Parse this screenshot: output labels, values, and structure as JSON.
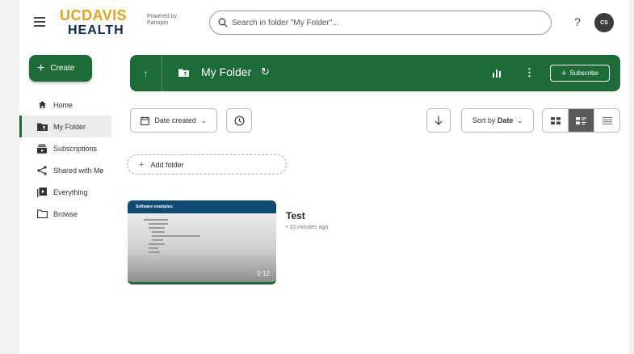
{
  "header": {
    "logo_uc": "UCDAVIS",
    "logo_health": "HEALTH",
    "powered_line1": "Powered by",
    "powered_line2": "Panopto",
    "search_placeholder": "Search in folder \"My Folder\"...",
    "help": "?",
    "avatar_initials": "CS"
  },
  "sidebar": {
    "create_label": "Create",
    "items": [
      {
        "label": "Home",
        "icon": "home-icon"
      },
      {
        "label": "My Folder",
        "icon": "folder-user-icon",
        "active": true
      },
      {
        "label": "Subscriptions",
        "icon": "subscriptions-icon"
      },
      {
        "label": "Shared with Me",
        "icon": "share-icon"
      },
      {
        "label": "Everything",
        "icon": "library-icon"
      },
      {
        "label": "Browse",
        "icon": "folder-icon"
      }
    ]
  },
  "folderbar": {
    "title": "My Folder",
    "subscribe_label": "Subscribe",
    "accent_color": "#1e6b3a"
  },
  "toolbar": {
    "date_filter_label": "Date created",
    "sort_label_prefix": "Sort by",
    "sort_label_value": "Date",
    "active_view": "detail-view"
  },
  "add_folder_label": "Add folder",
  "videos": [
    {
      "title": "Test",
      "meta": "• 10 minutes ago",
      "duration": "0:12",
      "thumb_heading": "Software examples:"
    }
  ]
}
